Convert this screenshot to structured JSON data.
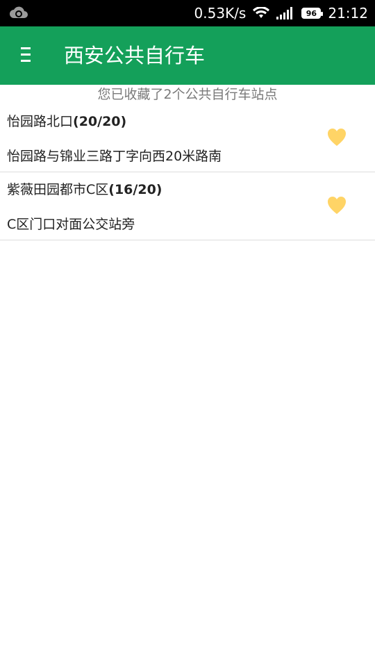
{
  "status_bar": {
    "speed": "0.53K/s",
    "battery": "96",
    "time": "21:12"
  },
  "header": {
    "title": "西安公共自行车"
  },
  "summary": "您已收藏了2个公共自行车站点",
  "stations": [
    {
      "name": "怡园路北口",
      "count": "(20/20)",
      "address": "怡园路与锦业三路丁字向西20米路南"
    },
    {
      "name": "紫薇田园都市C区",
      "count": "(16/20)",
      "address": "C区门口对面公交站旁"
    }
  ],
  "colors": {
    "app_bar": "#14a05a",
    "heart": "#ffd466"
  }
}
